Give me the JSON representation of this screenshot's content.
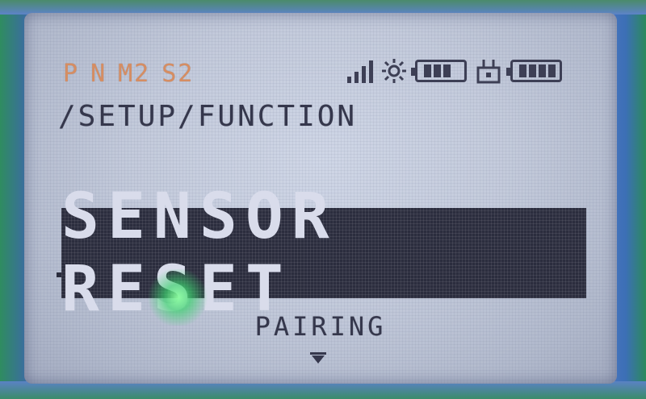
{
  "status": {
    "modes": [
      "P",
      "N",
      "M2",
      "S2"
    ],
    "signal_bars": 4,
    "battery_transmitter_level": 0.75,
    "battery_receiver_level": 1.0,
    "icons": [
      "signal-strength-icon",
      "backlight-sun-icon",
      "transmitter-battery-icon",
      "receiver-plug-icon",
      "receiver-battery-icon"
    ]
  },
  "breadcrumb": "/SETUP/FUNCTION",
  "menu": {
    "selected": "SENSOR RESET",
    "next": "PAIRING"
  },
  "colors": {
    "lcd_background": "#c3cadb",
    "pixel_dark": "#35374c",
    "status_orange": "#d68d62",
    "highlight_bar": "#2b2d3e",
    "highlight_text": "#d9dceb",
    "led_glow": "#3cd26e"
  }
}
